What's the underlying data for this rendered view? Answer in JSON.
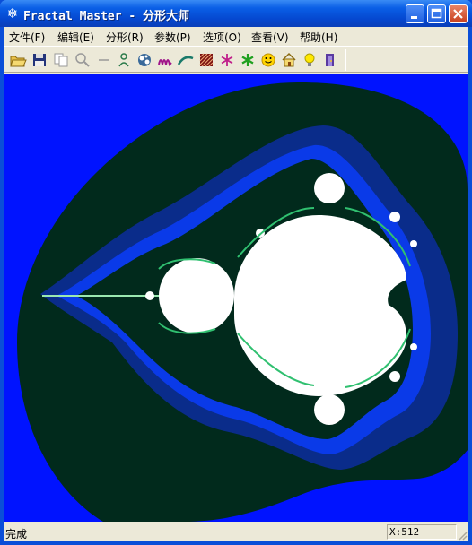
{
  "window": {
    "title": "Fractal Master - 分形大师",
    "icon": "snowflake-icon"
  },
  "menu": [
    {
      "label": "文件(F)"
    },
    {
      "label": "编辑(E)"
    },
    {
      "label": "分形(R)"
    },
    {
      "label": "参数(P)"
    },
    {
      "label": "选项(O)"
    },
    {
      "label": "查看(V)"
    },
    {
      "label": "帮助(H)"
    }
  ],
  "toolbar": [
    {
      "icon": "open-folder-icon"
    },
    {
      "icon": "save-icon"
    },
    {
      "icon": "copy-icon"
    },
    {
      "icon": "zoom-icon"
    },
    {
      "icon": "line-icon"
    },
    {
      "icon": "tree-fractal-icon"
    },
    {
      "icon": "julia-set-icon"
    },
    {
      "icon": "curve-m-icon"
    },
    {
      "icon": "fern-icon"
    },
    {
      "icon": "texture-icon"
    },
    {
      "icon": "snowflake-red-icon"
    },
    {
      "icon": "snowflake-green-icon"
    },
    {
      "icon": "smiley-icon"
    },
    {
      "icon": "home-icon"
    },
    {
      "icon": "help-bulb-icon"
    },
    {
      "icon": "exit-icon"
    }
  ],
  "colors": {
    "bg_blue": "#0013FF",
    "dark": "#012A1C",
    "band": "#0A2C8A",
    "set": "#FFFFFF"
  },
  "status": {
    "text": "完成",
    "coord": "X:512"
  }
}
